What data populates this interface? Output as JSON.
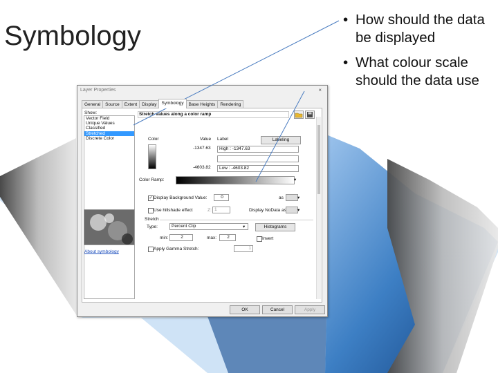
{
  "slide": {
    "title": "Symbology",
    "bullets": [
      "How should the data be displayed",
      "What colour scale should the data use"
    ]
  },
  "dialog": {
    "title": "Layer Properties",
    "close_glyph": "×",
    "tabs": [
      "General",
      "Source",
      "Extent",
      "Display",
      "Symbology",
      "Base Heights",
      "Rendering"
    ],
    "active_tab": "Symbology",
    "show_label": "Show:",
    "renderers": [
      "Vector Field",
      "Unique Values",
      "Classified",
      "Stretched",
      "Discrete Color"
    ],
    "selected_renderer": "Stretched",
    "about_link": "About symbology",
    "heading": "Stretch values along a color ramp",
    "columns": {
      "color": "Color",
      "value": "Value",
      "label": "Label",
      "labeling": "Labeling"
    },
    "high": {
      "value": "-1347.63",
      "label": "High : -1347.63"
    },
    "low": {
      "value": "-4603.82",
      "label": "Low : -4603.82"
    },
    "color_ramp_label": "Color Ramp:",
    "display_bg": {
      "label": "Display Background Value:",
      "value": "0",
      "as": "as",
      "checked": true
    },
    "hillshade": {
      "label": "Use hillshade effect",
      "z_label": "Z:",
      "z_value": "1",
      "checked": false
    },
    "nodata_label": "Display NoData as",
    "stretch": {
      "section": "Stretch",
      "type_label": "Type:",
      "type_value": "Percent Clip",
      "histograms": "Histograms",
      "min_label": "min:",
      "min_value": "2",
      "max_label": "max:",
      "max_value": "2",
      "invert": "Invert",
      "gamma": "Apply Gamma Stretch:",
      "gamma_value": "1"
    },
    "buttons": {
      "ok": "OK",
      "cancel": "Cancel",
      "apply": "Apply"
    }
  },
  "colors": {
    "selection": "#3399ff",
    "terrain_blue": "#3d7fc4",
    "link": "#1a4dbd"
  }
}
